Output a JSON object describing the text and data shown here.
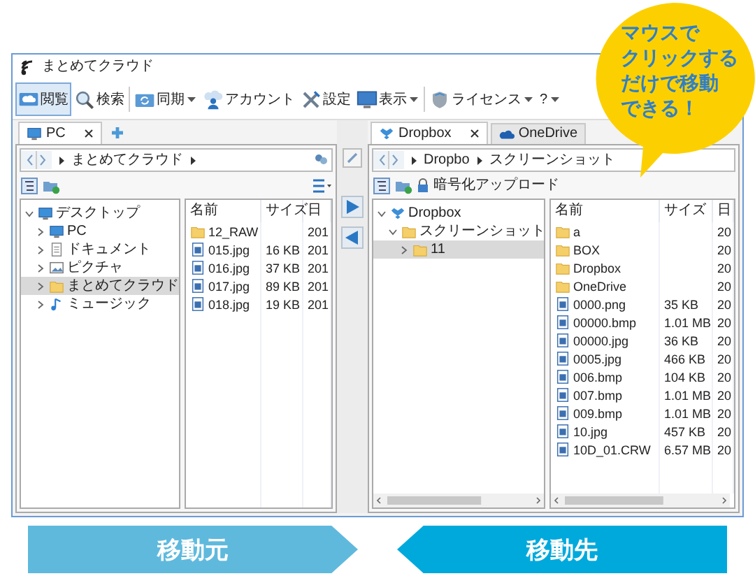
{
  "window": {
    "title": "まとめてクラウド"
  },
  "toolbar": [
    {
      "kind": "browse",
      "label": "閲覧",
      "selected": true,
      "dropdown": false
    },
    {
      "kind": "search",
      "label": "検索",
      "selected": false,
      "dropdown": false
    },
    {
      "kind": "sync",
      "label": "同期",
      "selected": false,
      "dropdown": true
    },
    {
      "kind": "account",
      "label": "アカウント",
      "selected": false,
      "dropdown": false
    },
    {
      "kind": "settings",
      "label": "設定",
      "selected": false,
      "dropdown": false
    },
    {
      "kind": "view",
      "label": "表示",
      "selected": false,
      "dropdown": true
    },
    {
      "kind": "license",
      "label": "ライセンス",
      "selected": false,
      "dropdown": true
    },
    {
      "kind": "help",
      "label": "?",
      "selected": false,
      "dropdown": true
    }
  ],
  "panes": [
    {
      "kind": "local",
      "tabs": [
        {
          "kind": "pc",
          "label": "PC",
          "selected": true,
          "closable": true
        }
      ],
      "address": [
        "まとめてクラウド"
      ],
      "tree": [
        {
          "kind": "desktop",
          "label": "デスクトップ",
          "expanded": true,
          "selected": false,
          "children": [
            {
              "kind": "pc",
              "label": "PC",
              "expanded": false,
              "selected": false
            },
            {
              "kind": "document",
              "label": "ドキュメント",
              "expanded": false,
              "selected": false
            },
            {
              "kind": "picture",
              "label": "ピクチャ",
              "expanded": false,
              "selected": false
            },
            {
              "kind": "folder",
              "label": "まとめてクラウド",
              "expanded": false,
              "selected": true
            },
            {
              "kind": "music",
              "label": "ミュージック",
              "expanded": false,
              "selected": false
            }
          ]
        }
      ],
      "columns": [
        "名前",
        "サイズ",
        "日"
      ],
      "files": [
        {
          "kind": "folder",
          "name": "12_RAW",
          "date": "201"
        },
        {
          "kind": "image",
          "name": "015.jpg",
          "size": "16 KB",
          "date": "201"
        },
        {
          "kind": "image",
          "name": "016.jpg",
          "size": "37 KB",
          "date": "201"
        },
        {
          "kind": "image",
          "name": "017.jpg",
          "size": "89 KB",
          "date": "201"
        },
        {
          "kind": "image",
          "name": "018.jpg",
          "size": "19 KB",
          "date": "201"
        }
      ]
    },
    {
      "kind": "cloud",
      "tabs": [
        {
          "kind": "dropbox",
          "label": "Dropbox",
          "selected": true,
          "closable": true
        },
        {
          "kind": "cloud",
          "label": "OneDrive",
          "selected": false,
          "closable": false
        }
      ],
      "address": [
        "Dropbo",
        "スクリーンショット"
      ],
      "upload_label": "暗号化アップロード",
      "tree": [
        {
          "kind": "dropbox",
          "label": "Dropbox",
          "expanded": true,
          "selected": false,
          "children": [
            {
              "kind": "folder",
              "label": "スクリーンショット",
              "expanded": true,
              "selected": false,
              "children": [
                {
                  "kind": "folder",
                  "label": "11",
                  "expanded": false,
                  "selected": true
                }
              ]
            }
          ]
        }
      ],
      "columns": [
        "名前",
        "サイズ",
        "日"
      ],
      "files": [
        {
          "kind": "folder",
          "name": "a",
          "date": "20"
        },
        {
          "kind": "folder",
          "name": "BOX",
          "date": "20"
        },
        {
          "kind": "folder",
          "name": "Dropbox",
          "date": "20"
        },
        {
          "kind": "folder",
          "name": "OneDrive",
          "date": "20"
        },
        {
          "kind": "image",
          "name": "0000.png",
          "size": "35 KB",
          "date": "20"
        },
        {
          "kind": "image",
          "name": "00000.bmp",
          "size": "1.01 MB",
          "date": "20"
        },
        {
          "kind": "image",
          "name": "00000.jpg",
          "size": "36 KB",
          "date": "20"
        },
        {
          "kind": "image",
          "name": "0005.jpg",
          "size": "466 KB",
          "date": "20"
        },
        {
          "kind": "image",
          "name": "006.bmp",
          "size": "104 KB",
          "date": "20"
        },
        {
          "kind": "image",
          "name": "007.bmp",
          "size": "1.01 MB",
          "date": "20"
        },
        {
          "kind": "image",
          "name": "009.bmp",
          "size": "1.01 MB",
          "date": "20"
        },
        {
          "kind": "image",
          "name": "10.jpg",
          "size": "457 KB",
          "date": "20"
        },
        {
          "kind": "image",
          "name": "10D_01.CRW",
          "size": "6.57 MB",
          "date": "20"
        }
      ]
    }
  ],
  "transfer_buttons": [
    {
      "kind": "right"
    },
    {
      "kind": "left"
    }
  ],
  "callout": {
    "lines": [
      "マウスで",
      "クリックする",
      "だけで移動",
      "できる！"
    ]
  },
  "banners": [
    {
      "kind": "source",
      "label": "移動元",
      "color": "#5fb9dd"
    },
    {
      "kind": "target",
      "label": "移動先",
      "color": "#00a9dc"
    }
  ]
}
